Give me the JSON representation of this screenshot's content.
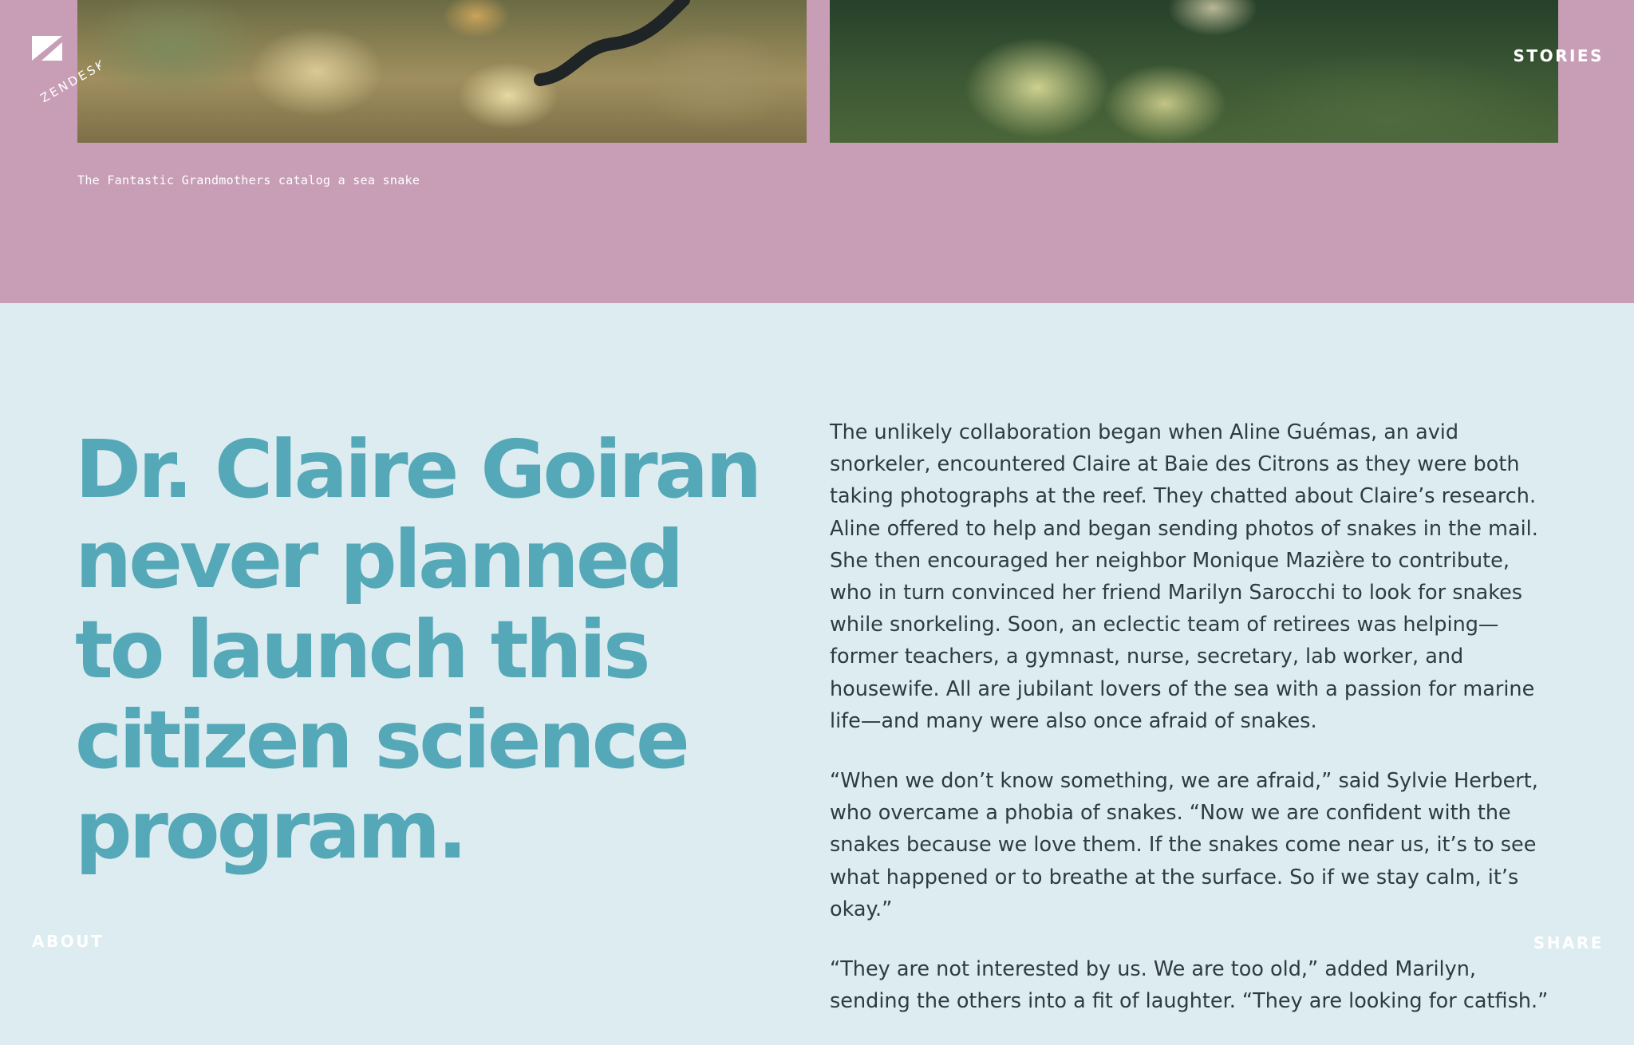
{
  "brand": {
    "logo_text": "ZENDESK"
  },
  "nav": {
    "stories": "STORIES",
    "about": "ABOUT",
    "share": "SHARE"
  },
  "gallery": {
    "caption": "The Fantastic Grandmothers catalog a sea snake"
  },
  "article": {
    "headline": "Dr. Claire Goiran never planned to launch this citizen science program.",
    "paragraphs": [
      "The unlikely collaboration began when Aline Guémas, an avid snorkeler, encountered Claire at Baie des Citrons as they were both taking photographs at the reef. They chatted about Claire’s research. Aline offered to help and began sending photos of snakes in the mail. She then encouraged her neighbor Monique Mazière to contribute, who in turn convinced her friend Marilyn Sarocchi to look for snakes while snorkeling. Soon, an eclectic team of retirees was helping—former teachers, a gymnast, nurse, secretary, lab worker, and housewife. All are jubilant lovers of the sea with a passion for marine life—and many were also once afraid of snakes.",
      "“When we don’t know something, we are afraid,” said Sylvie Herbert, who overcame a phobia of snakes. “Now we are confident with the snakes because we love them. If the snakes come near us, it’s to see what happened or to breathe at the surface. So if we stay calm, it’s okay.”",
      "“They are not interested by us. We are too old,” added Marilyn, sending the others into a fit of laughter. “They are looking for catfish.”"
    ]
  },
  "colors": {
    "pink_band": "#c89eb7",
    "light_background": "#dcecf0",
    "headline_teal": "#55a8b8",
    "body_text": "#2f3a44"
  }
}
